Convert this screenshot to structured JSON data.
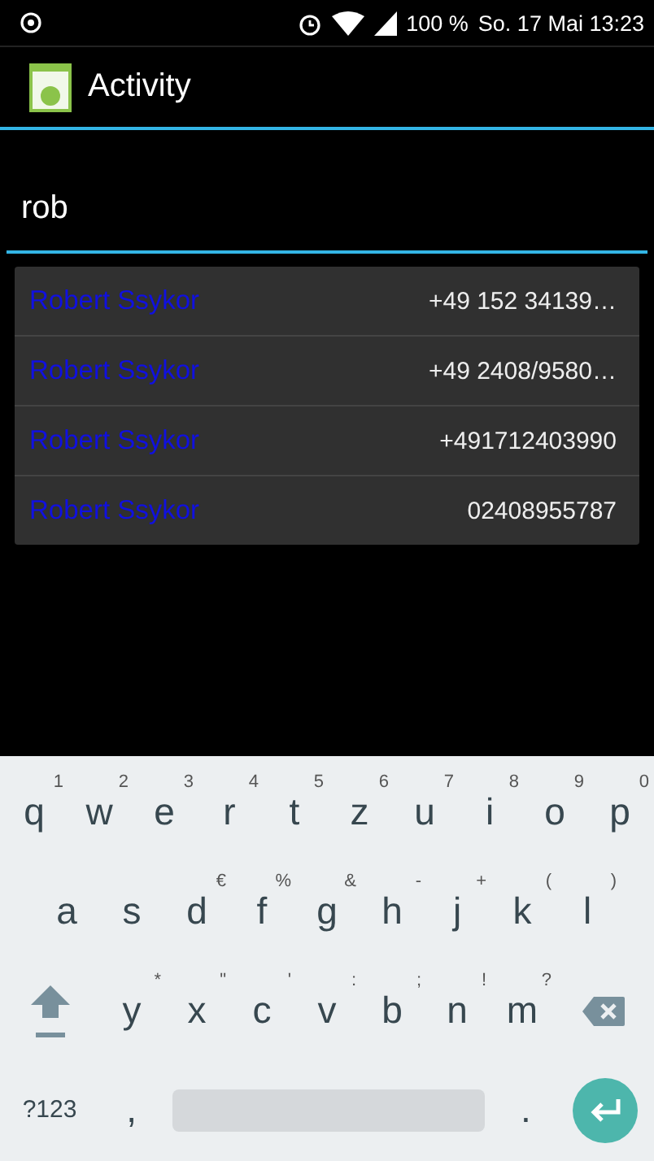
{
  "status_bar": {
    "battery": "100 %",
    "datetime": "So. 17 Mai 13:23"
  },
  "action_bar": {
    "title": "Activity"
  },
  "search": {
    "value": "rob"
  },
  "suggestions": [
    {
      "name": "Robert Ssykor",
      "phone": "+49 152 34139…"
    },
    {
      "name": "Robert Ssykor",
      "phone": "+49 2408/9580…"
    },
    {
      "name": "Robert Ssykor",
      "phone": "+491712403990"
    },
    {
      "name": "Robert Ssykor",
      "phone": "02408955787"
    }
  ],
  "keyboard": {
    "rows": [
      {
        "keys": [
          {
            "kind": "letter",
            "label": "q",
            "hint": "1"
          },
          {
            "kind": "letter",
            "label": "w",
            "hint": "2"
          },
          {
            "kind": "letter",
            "label": "e",
            "hint": "3"
          },
          {
            "kind": "letter",
            "label": "r",
            "hint": "4"
          },
          {
            "kind": "letter",
            "label": "t",
            "hint": "5"
          },
          {
            "kind": "letter",
            "label": "z",
            "hint": "6"
          },
          {
            "kind": "letter",
            "label": "u",
            "hint": "7"
          },
          {
            "kind": "letter",
            "label": "i",
            "hint": "8"
          },
          {
            "kind": "letter",
            "label": "o",
            "hint": "9"
          },
          {
            "kind": "letter",
            "label": "p",
            "hint": "0"
          }
        ]
      },
      {
        "keys": [
          {
            "kind": "letter",
            "label": "a"
          },
          {
            "kind": "letter",
            "label": "s"
          },
          {
            "kind": "letter",
            "label": "d",
            "hint": "€"
          },
          {
            "kind": "letter",
            "label": "f",
            "hint": "%"
          },
          {
            "kind": "letter",
            "label": "g",
            "hint": "&"
          },
          {
            "kind": "letter",
            "label": "h",
            "hint": "-"
          },
          {
            "kind": "letter",
            "label": "j",
            "hint": "+"
          },
          {
            "kind": "letter",
            "label": "k",
            "hint": "("
          },
          {
            "kind": "letter",
            "label": "l",
            "hint": ")"
          }
        ]
      },
      {
        "keys": [
          {
            "kind": "shift"
          },
          {
            "kind": "letter",
            "label": "y",
            "hint": "*"
          },
          {
            "kind": "letter",
            "label": "x",
            "hint": "\""
          },
          {
            "kind": "letter",
            "label": "c",
            "hint": "'"
          },
          {
            "kind": "letter",
            "label": "v",
            "hint": ":"
          },
          {
            "kind": "letter",
            "label": "b",
            "hint": ";"
          },
          {
            "kind": "letter",
            "label": "n",
            "hint": "!"
          },
          {
            "kind": "letter",
            "label": "m",
            "hint": "?"
          },
          {
            "kind": "backspace"
          }
        ]
      },
      {
        "keys": [
          {
            "kind": "symbols",
            "label": "?123"
          },
          {
            "kind": "punctuation",
            "label": ","
          },
          {
            "kind": "space"
          },
          {
            "kind": "punctuation",
            "label": "."
          },
          {
            "kind": "enter"
          }
        ]
      }
    ]
  }
}
